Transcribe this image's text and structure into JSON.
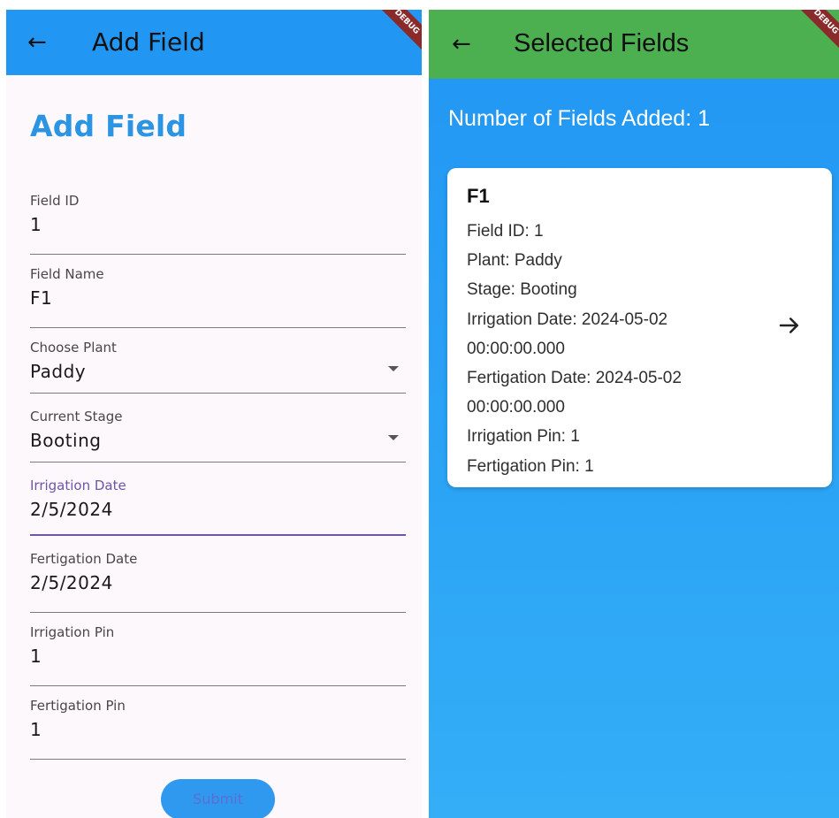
{
  "left": {
    "appbar": {
      "back_icon": "arrow-left-icon",
      "title": "Add Field",
      "debug_banner": "DEBUG"
    },
    "heading": "Add Field",
    "fields": [
      {
        "label": "Field ID",
        "value": "1",
        "type": "text"
      },
      {
        "label": "Field Name",
        "value": "F1",
        "type": "text"
      },
      {
        "label": "Choose Plant",
        "value": "Paddy",
        "type": "dropdown"
      },
      {
        "label": "Current Stage",
        "value": "Booting",
        "type": "dropdown"
      },
      {
        "label": "Irrigation Date",
        "value": "2/5/2024",
        "type": "date",
        "focused": true
      },
      {
        "label": "Fertigation Date",
        "value": "2/5/2024",
        "type": "date"
      },
      {
        "label": "Irrigation Pin",
        "value": "1",
        "type": "text"
      },
      {
        "label": "Fertigation Pin",
        "value": "1",
        "type": "text"
      }
    ],
    "submit_label": "Submit"
  },
  "right": {
    "appbar": {
      "back_icon": "arrow-left-icon",
      "title": "Selected Fields",
      "debug_banner": "DEBUG"
    },
    "count_text": "Number of Fields Added: 1",
    "card": {
      "title": "F1",
      "lines": [
        "Field ID: 1",
        "Plant: Paddy",
        "Stage: Booting",
        "Irrigation Date: 2024-05-02",
        "00:00:00.000",
        "Fertigation Date: 2024-05-02",
        "00:00:00.000",
        "Irrigation Pin: 1",
        "Fertigation Pin: 1"
      ],
      "action_icon": "arrow-right-icon"
    }
  },
  "colors": {
    "left_appbar": "#2196f3",
    "right_appbar": "#4caf50",
    "heading": "#2b95e3",
    "focus": "#6f54a8",
    "submit": "#2f98ef"
  }
}
